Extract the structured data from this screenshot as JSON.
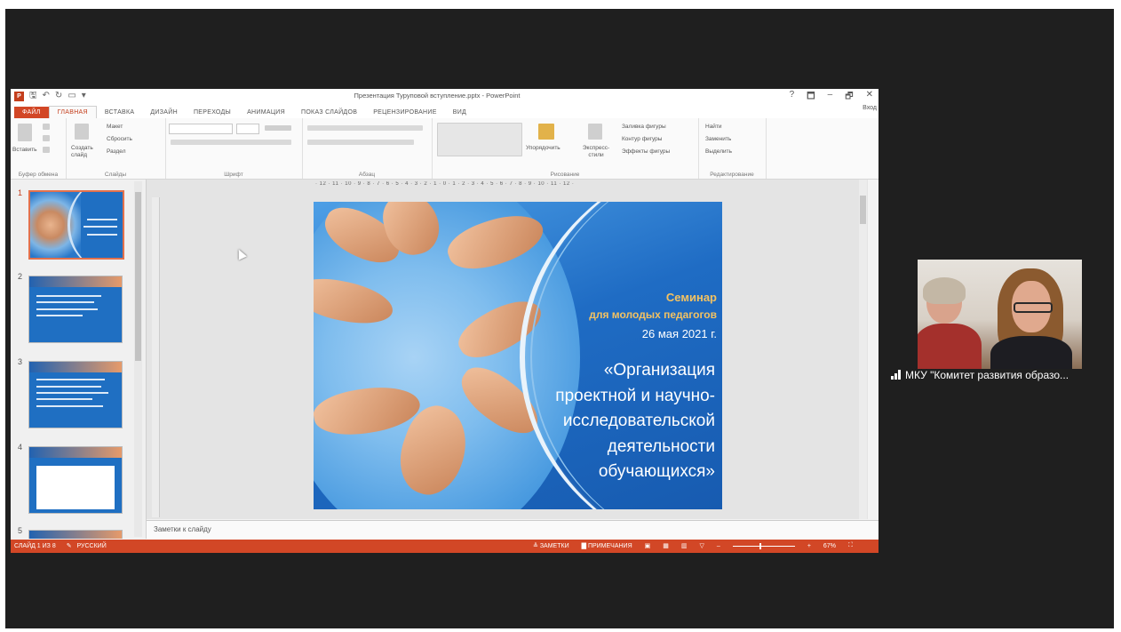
{
  "titlebar": {
    "doc_title": "Презентация Туруповой вступление.pptx - PowerPoint",
    "help": "?",
    "restore": "🗖",
    "minimize": "–",
    "maximize": "🗗",
    "close": "✕",
    "signin": "Вход"
  },
  "tabs": [
    {
      "label": "ФАЙЛ"
    },
    {
      "label": "ГЛАВНАЯ"
    },
    {
      "label": "ВСТАВКА"
    },
    {
      "label": "ДИЗАЙН"
    },
    {
      "label": "ПЕРЕХОДЫ"
    },
    {
      "label": "АНИМАЦИЯ"
    },
    {
      "label": "ПОКАЗ СЛАЙДОВ"
    },
    {
      "label": "РЕЦЕНЗИРОВАНИЕ"
    },
    {
      "label": "ВИД"
    }
  ],
  "ribbon": {
    "clipboard": {
      "paste": "Вставить",
      "label": "Буфер обмена"
    },
    "slides": {
      "new_slide": "Создать слайд",
      "layout": "Макет",
      "reset": "Сбросить",
      "section": "Раздел",
      "label": "Слайды"
    },
    "font": {
      "label": "Шрифт"
    },
    "paragraph": {
      "label": "Абзац"
    },
    "drawing": {
      "arrange": "Упорядочить",
      "quick_styles": "Экспресс-стили",
      "fill": "Заливка фигуры",
      "outline": "Контур фигуры",
      "effects": "Эффекты фигуры",
      "label": "Рисование"
    },
    "editing": {
      "find": "Найти",
      "replace": "Заменить",
      "select": "Выделить",
      "label": "Редактирование"
    }
  },
  "ruler": "· 12 · 11 · 10 · 9 · 8 · 7 · 6 · 5 · 4 · 3 · 2 · 1 · 0 · 1 · 2 · 3 · 4 · 5 · 6 · 7 · 8 · 9 · 10 · 11 · 12 ·",
  "thumbnails": [
    {
      "num": "1"
    },
    {
      "num": "2"
    },
    {
      "num": "3"
    },
    {
      "num": "4"
    },
    {
      "num": "5"
    }
  ],
  "slide": {
    "seminar": "Семинар",
    "audience": "для молодых педагогов",
    "date": "26 мая 2021 г.",
    "title_lines": [
      "«Организация",
      "проектной и научно-",
      "исследовательской",
      "деятельности",
      "обучающихся»"
    ]
  },
  "notes": {
    "placeholder": "Заметки к слайду"
  },
  "statusbar": {
    "slide_info": "СЛАЙД 1 ИЗ 8",
    "language": "РУССКИЙ",
    "notes_btn": "ЗАМЕТКИ",
    "comments_btn": "ПРИМЕЧАНИЯ",
    "zoom": "67%"
  },
  "participant": {
    "name": "МКУ \"Комитет развития образо..."
  },
  "colors": {
    "accent": "#d24726",
    "slide_blue": "#1b66bd",
    "slide_gold": "#f3c262"
  }
}
